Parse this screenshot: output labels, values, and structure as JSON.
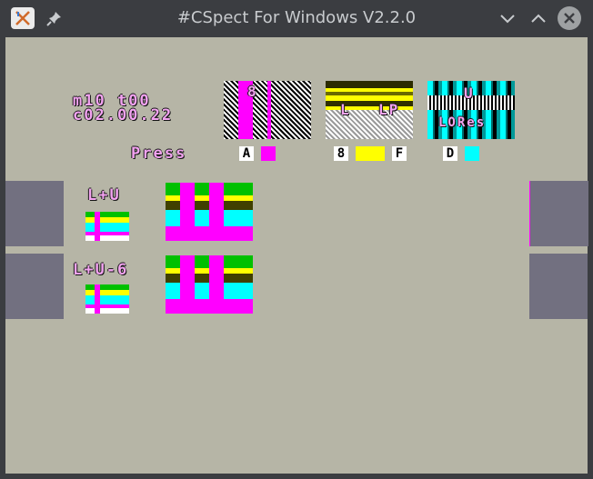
{
  "window": {
    "title": "#CSpect For Windows V2.2.0"
  },
  "icons": {
    "app": "cspect-x-icon",
    "pin": "pin-icon",
    "minimize": "chevron-down-icon",
    "maximize": "chevron-up-icon",
    "close": "close-icon"
  },
  "screen": {
    "line1": "m10  t00",
    "line2": "c02.00.22",
    "press_label": "Press",
    "keys": [
      {
        "key": "A",
        "color": "#ff00ff"
      },
      {
        "key": "8",
        "color": "#ffff00"
      },
      {
        "key": "F",
        "color": ""
      },
      {
        "key": "D",
        "color": "#00ffff"
      }
    ],
    "tile_labels": {
      "tile1": "8",
      "tile2_a": "L",
      "tile2_b": "LP",
      "tile3_a": "U",
      "tile3_b": "LORes"
    },
    "row_labels": [
      "L+U",
      "L+U-6"
    ],
    "colors": {
      "magenta": "#ff00ff",
      "yellow": "#ffff00",
      "cyan": "#00ffff",
      "green": "#00c000",
      "bg": "#b6b5a6",
      "border": "#727080"
    }
  }
}
